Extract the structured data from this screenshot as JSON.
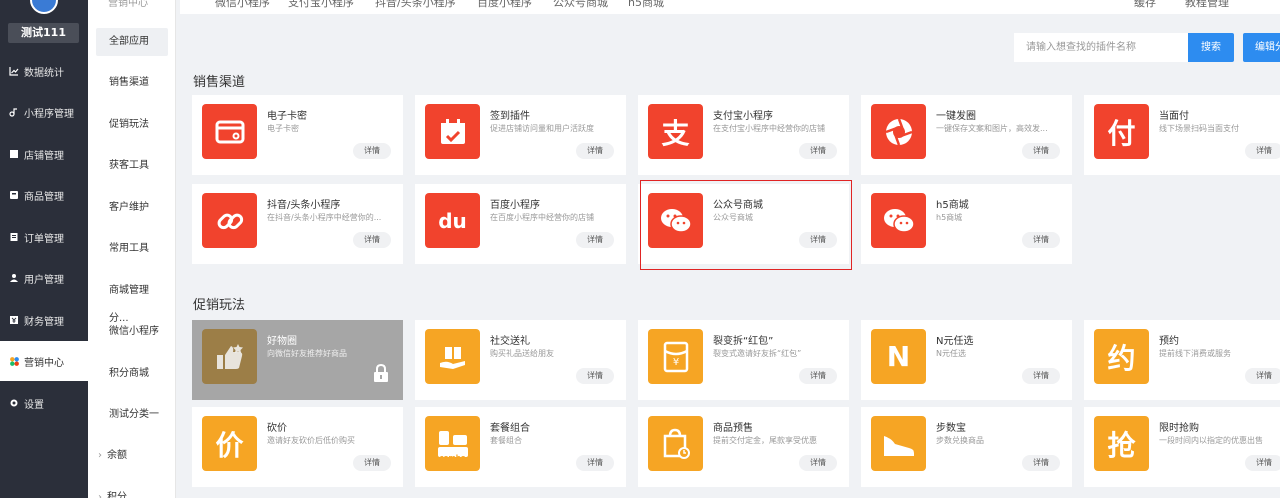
{
  "sidebar": {
    "shop_name": "测试111",
    "items": [
      {
        "label": "数据统计",
        "icon": "chart-icon",
        "active": false
      },
      {
        "label": "小程序管理",
        "icon": "link-icon",
        "active": false
      },
      {
        "label": "店铺管理",
        "icon": "store-icon",
        "active": false
      },
      {
        "label": "商品管理",
        "icon": "goods-icon",
        "active": false
      },
      {
        "label": "订单管理",
        "icon": "order-icon",
        "active": false
      },
      {
        "label": "用户管理",
        "icon": "user-icon",
        "active": false
      },
      {
        "label": "财务管理",
        "icon": "finance-icon",
        "active": false
      },
      {
        "label": "营销中心",
        "icon": "marketing-icon",
        "active": true
      },
      {
        "label": "设置",
        "icon": "settings-icon",
        "active": false
      }
    ]
  },
  "submenu": {
    "top_label": "营销中心",
    "items": [
      {
        "label": "全部应用",
        "active": true
      },
      {
        "label": "销售渠道",
        "active": false
      },
      {
        "label": "促销玩法",
        "active": false
      },
      {
        "label": "获客工具",
        "active": false
      },
      {
        "label": "客户维护",
        "active": false
      },
      {
        "label": "常用工具",
        "active": false
      },
      {
        "label": "商城管理分...",
        "active": false
      },
      {
        "label": "微信小程序",
        "active": false
      },
      {
        "label": "积分商城",
        "active": false
      },
      {
        "label": "测试分类一",
        "active": false
      },
      {
        "label": "余额",
        "active": false,
        "caret": "›"
      },
      {
        "label": "积分",
        "active": false,
        "caret": "›"
      }
    ]
  },
  "topbar": {
    "tabs": [
      "微信小程序",
      "支付宝小程序",
      "抖音/头条小程序",
      "百度小程序",
      "公众号商城",
      "h5商城"
    ],
    "right": [
      "缓存",
      "教程管理"
    ]
  },
  "search": {
    "placeholder": "请输入想查找的插件名称",
    "button_label": "搜索",
    "edit_label": "编辑分类"
  },
  "sections": [
    {
      "title": "销售渠道",
      "cards": [
        {
          "title": "电子卡密",
          "desc": "电子卡密",
          "detail": "详情",
          "color": "#f1432d",
          "icon": "card-wallet-icon"
        },
        {
          "title": "签到插件",
          "desc": "促进店铺访问量和用户活跃度",
          "detail": "详情",
          "color": "#f1432d",
          "icon": "calendar-check-icon"
        },
        {
          "title": "支付宝小程序",
          "desc": "在支付宝小程序中经营你的店铺",
          "detail": "详情",
          "color": "#f1432d",
          "icon": "alipay-icon",
          "glyph": "支"
        },
        {
          "title": "一键发圈",
          "desc": "一键保存文案和图片，高效发...",
          "detail": "详情",
          "color": "#f1432d",
          "icon": "aperture-icon"
        },
        {
          "title": "当面付",
          "desc": "线下场景扫码当面支付",
          "detail": "详情",
          "color": "#f1432d",
          "icon": "scan-pay-icon",
          "glyph": "付"
        },
        {
          "title": "抖音/头条小程序",
          "desc": "在抖音/头条小程序中经营你的...",
          "detail": "详情",
          "color": "#f1432d",
          "icon": "link-chain-icon"
        },
        {
          "title": "百度小程序",
          "desc": "在百度小程序中经营你的店铺",
          "detail": "详情",
          "color": "#f1432d",
          "icon": "baidu-icon",
          "glyph": "du"
        },
        {
          "title": "公众号商城",
          "desc": "公众号商城",
          "detail": "详情",
          "color": "#f1432d",
          "icon": "wechat-icon"
        },
        {
          "title": "h5商城",
          "desc": "h5商城",
          "detail": "详情",
          "color": "#f1432d",
          "icon": "wechat-icon"
        }
      ]
    },
    {
      "title": "促销玩法",
      "cards": [
        {
          "title": "好物圈",
          "desc": "向微信好友推荐好商品",
          "detail": "",
          "color": "#9b7a3d",
          "icon": "thumbs-up-icon",
          "disabled": true
        },
        {
          "title": "社交送礼",
          "desc": "购买礼品送给朋友",
          "detail": "详情",
          "color": "#f6a524",
          "icon": "gift-hand-icon"
        },
        {
          "title": "裂变拆“红包”",
          "desc": "裂变式邀请好友拆“红包”",
          "detail": "详情",
          "color": "#f6a524",
          "icon": "red-packet-icon"
        },
        {
          "title": "N元任选",
          "desc": "N元任选",
          "detail": "详情",
          "color": "#f6a524",
          "icon": "letter-n-icon",
          "glyph": "N"
        },
        {
          "title": "预约",
          "desc": "提前线下消费或服务",
          "detail": "详情",
          "color": "#f6a524",
          "icon": "appointment-icon",
          "glyph": "约"
        },
        {
          "title": "砍价",
          "desc": "邀请好友砍价后低价购买",
          "detail": "详情",
          "color": "#f6a524",
          "icon": "bargain-icon",
          "glyph": "价"
        },
        {
          "title": "套餐组合",
          "desc": "套餐组合",
          "detail": "详情",
          "color": "#f6a524",
          "icon": "combo-icon",
          "badge": "combo"
        },
        {
          "title": "商品预售",
          "desc": "提前交付定金，尾款享受优惠",
          "detail": "详情",
          "color": "#f6a524",
          "icon": "presale-bag-icon"
        },
        {
          "title": "步数宝",
          "desc": "步数兑换商品",
          "detail": "详情",
          "color": "#f6a524",
          "icon": "shoe-icon"
        },
        {
          "title": "限时抢购",
          "desc": "一段时间内以指定的优惠出售",
          "detail": "详情",
          "color": "#f6a524",
          "icon": "clock-grab-icon",
          "glyph": "抢"
        }
      ]
    }
  ]
}
